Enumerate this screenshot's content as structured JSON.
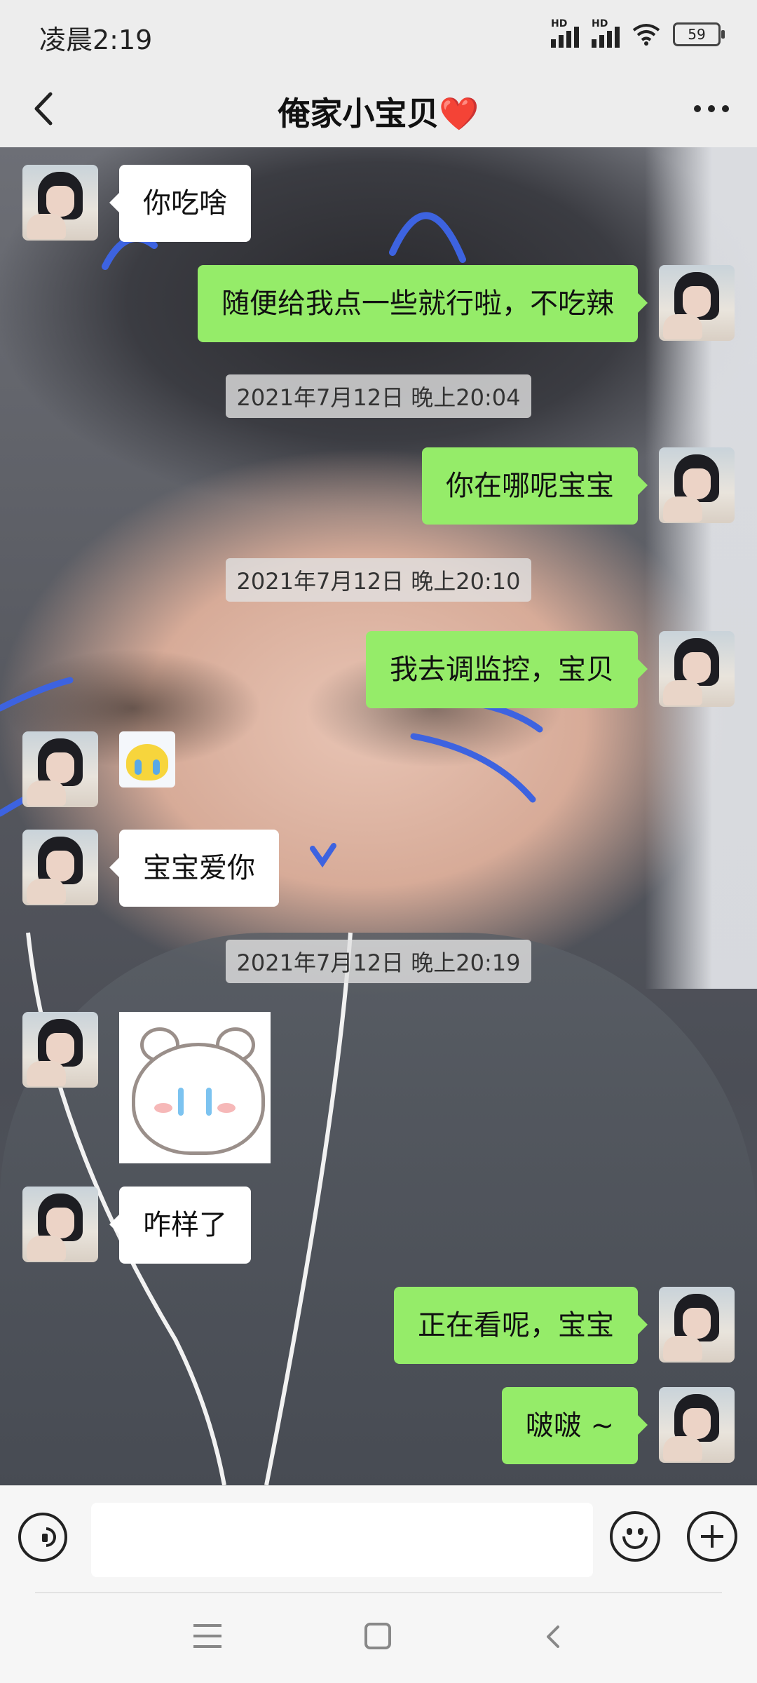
{
  "status_bar": {
    "time": "凌晨2:19",
    "signal_labels": [
      "HD",
      "HD"
    ],
    "battery_level": "59"
  },
  "header": {
    "title": "俺家小宝贝❤️",
    "back_icon": "chevron-left-icon",
    "more_icon": "ellipsis-icon"
  },
  "messages": [
    {
      "side": "in",
      "type": "text",
      "text": "你吃啥"
    },
    {
      "side": "out",
      "type": "text",
      "text": "随便给我点一些就行啦，不吃辣"
    },
    {
      "type": "time",
      "text": "2021年7月12日 晚上20:04"
    },
    {
      "side": "out",
      "type": "text",
      "text": "你在哪呢宝宝"
    },
    {
      "type": "time",
      "text": "2021年7月12日 晚上20:10"
    },
    {
      "side": "out",
      "type": "text",
      "text": "我去调监控，宝贝"
    },
    {
      "side": "in",
      "type": "sticker",
      "sticker": "crying-pikachu-sticker"
    },
    {
      "side": "in",
      "type": "text",
      "text": "宝宝爱你"
    },
    {
      "type": "time",
      "text": "2021年7月12日 晚上20:19"
    },
    {
      "side": "in",
      "type": "sticker",
      "sticker": "crying-bear-sticker"
    },
    {
      "side": "in",
      "type": "text",
      "text": "咋样了"
    },
    {
      "side": "out",
      "type": "text",
      "text": "正在看呢，宝宝"
    },
    {
      "side": "out",
      "type": "text",
      "text": "啵啵 ~"
    }
  ],
  "input_bar": {
    "voice_icon": "voice-icon",
    "emoji_icon": "emoji-icon",
    "plus_icon": "plus-icon",
    "text_value": ""
  },
  "colors": {
    "outgoing_bubble": "#95ec69",
    "incoming_bubble": "#ffffff",
    "bar_background": "#ededed"
  }
}
